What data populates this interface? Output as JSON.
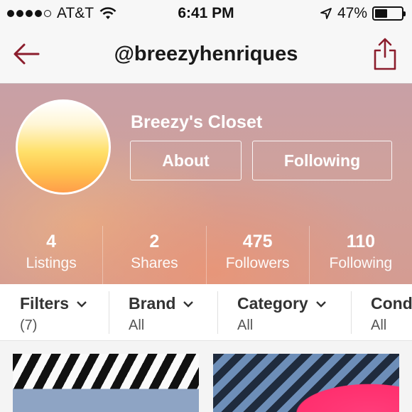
{
  "status_bar": {
    "carrier": "AT&T",
    "time": "6:41 PM",
    "battery_percent": "47%",
    "battery_level": 0.47,
    "icons": [
      "signal-dots-icon",
      "wifi-icon",
      "location-arrow-icon",
      "battery-icon"
    ]
  },
  "nav": {
    "title": "@breezyhenriques",
    "back_icon": "back-arrow-icon",
    "share_icon": "share-icon"
  },
  "profile": {
    "closet_name": "Breezy's Closet",
    "about_label": "About",
    "following_label": "Following",
    "stats": [
      {
        "value": "4",
        "label": "Listings"
      },
      {
        "value": "2",
        "label": "Shares"
      },
      {
        "value": "475",
        "label": "Followers"
      },
      {
        "value": "110",
        "label": "Following"
      }
    ]
  },
  "filters": [
    {
      "name": "Filters",
      "value": "(7)"
    },
    {
      "name": "Brand",
      "value": "All"
    },
    {
      "name": "Category",
      "value": "All"
    },
    {
      "name": "Cond",
      "value": "All"
    }
  ],
  "colors": {
    "accent": "#8b1d2c",
    "header_bg": "#f7f7f7"
  }
}
